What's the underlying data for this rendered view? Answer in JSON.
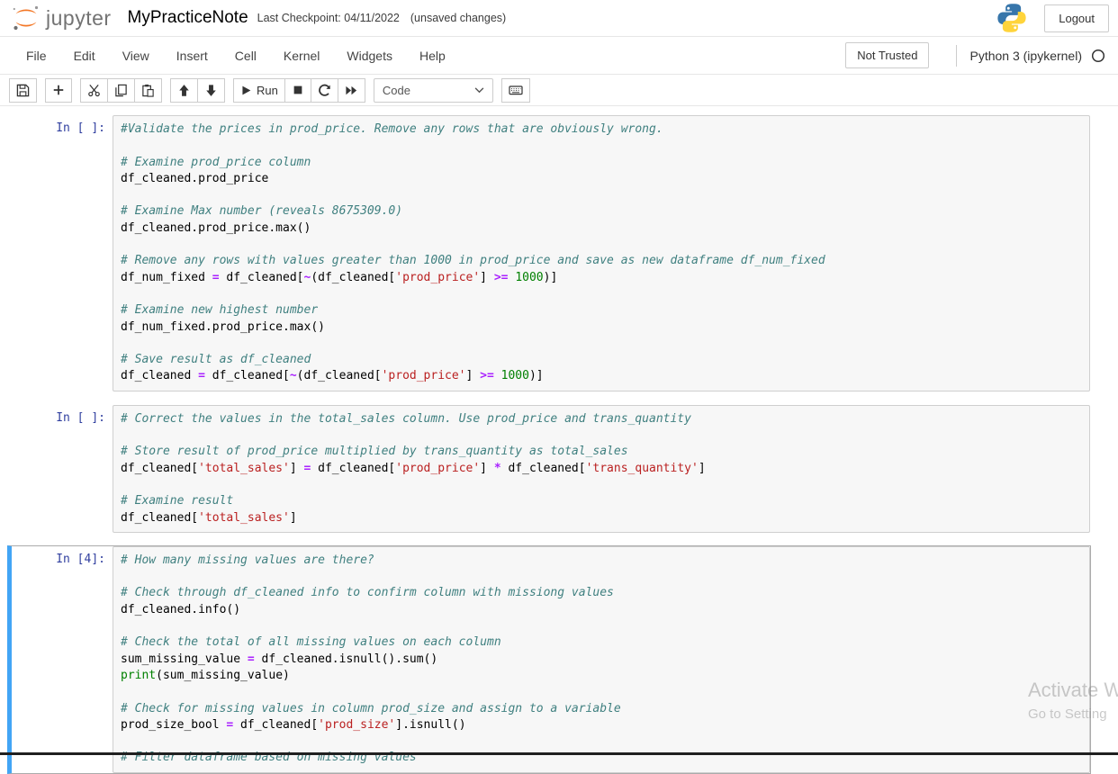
{
  "header": {
    "logo_text": "jupyter",
    "title": "MyPracticeNote",
    "checkpoint": "Last Checkpoint: 04/11/2022",
    "autosave_status": "(unsaved changes)",
    "logout_label": "Logout"
  },
  "menu": {
    "items": [
      "File",
      "Edit",
      "View",
      "Insert",
      "Cell",
      "Kernel",
      "Widgets",
      "Help"
    ],
    "not_trusted_label": "Not Trusted",
    "kernel_name": "Python 3 (ipykernel)"
  },
  "toolbar": {
    "run_label": "Run",
    "cell_type_value": "Code",
    "icons": [
      "save-icon",
      "add-cell-icon",
      "cut-cell-icon",
      "copy-cell-icon",
      "paste-cell-icon",
      "move-cell-up-icon",
      "move-cell-down-icon",
      "run-icon",
      "stop-icon",
      "restart-kernel-icon",
      "restart-run-all-icon",
      "dropdown-chevron-icon",
      "keyboard-icon",
      "kernel-idle-icon",
      "python-logo-icon",
      "jupyter-logo-icon"
    ]
  },
  "colors": {
    "jupyter_orange": "#F37726",
    "selected_cell_accent": "#42A5F5",
    "prompt_text": "#303F9F",
    "comment": "#408080",
    "string": "#BA2121",
    "operator": "#AA22FF",
    "number": "#008000",
    "builtin": "#008000"
  },
  "cells": [
    {
      "prompt": "In [ ]:",
      "selected": false,
      "lines": [
        [
          [
            "c",
            "#Validate the prices in prod_price. Remove any rows that are obviously wrong."
          ]
        ],
        [],
        [
          [
            "c",
            "# Examine prod_price column"
          ]
        ],
        [
          [
            "t",
            "df_cleaned.prod_price"
          ]
        ],
        [],
        [
          [
            "c",
            "# Examine Max number (reveals 8675309.0)"
          ]
        ],
        [
          [
            "t",
            "df_cleaned.prod_price.max()"
          ]
        ],
        [],
        [
          [
            "c",
            "# Remove any rows with values greater than 1000 in prod_price and save as new dataframe df_num_fixed"
          ]
        ],
        [
          [
            "t",
            "df_num_fixed "
          ],
          [
            "o",
            "="
          ],
          [
            "t",
            " df_cleaned["
          ],
          [
            "o",
            "~"
          ],
          [
            "t",
            "(df_cleaned["
          ],
          [
            "s",
            "'prod_price'"
          ],
          [
            "t",
            "] "
          ],
          [
            "o",
            ">="
          ],
          [
            "t",
            " "
          ],
          [
            "n",
            "1000"
          ],
          [
            "t",
            ")]"
          ]
        ],
        [],
        [
          [
            "c",
            "# Examine new highest number"
          ]
        ],
        [
          [
            "t",
            "df_num_fixed.prod_price.max()"
          ]
        ],
        [],
        [
          [
            "c",
            "# Save result as df_cleaned"
          ]
        ],
        [
          [
            "t",
            "df_cleaned "
          ],
          [
            "o",
            "="
          ],
          [
            "t",
            " df_cleaned["
          ],
          [
            "o",
            "~"
          ],
          [
            "t",
            "(df_cleaned["
          ],
          [
            "s",
            "'prod_price'"
          ],
          [
            "t",
            "] "
          ],
          [
            "o",
            ">="
          ],
          [
            "t",
            " "
          ],
          [
            "n",
            "1000"
          ],
          [
            "t",
            ")]"
          ]
        ]
      ]
    },
    {
      "prompt": "In [ ]:",
      "selected": false,
      "lines": [
        [
          [
            "c",
            "# Correct the values in the total_sales column. Use prod_price and trans_quantity"
          ]
        ],
        [],
        [
          [
            "c",
            "# Store result of prod_price multiplied by trans_quantity as total_sales"
          ]
        ],
        [
          [
            "t",
            "df_cleaned["
          ],
          [
            "s",
            "'total_sales'"
          ],
          [
            "t",
            "] "
          ],
          [
            "o",
            "="
          ],
          [
            "t",
            " df_cleaned["
          ],
          [
            "s",
            "'prod_price'"
          ],
          [
            "t",
            "] "
          ],
          [
            "o",
            "*"
          ],
          [
            "t",
            " df_cleaned["
          ],
          [
            "s",
            "'trans_quantity'"
          ],
          [
            "t",
            "]"
          ]
        ],
        [],
        [
          [
            "c",
            "# Examine result"
          ]
        ],
        [
          [
            "t",
            "df_cleaned["
          ],
          [
            "s",
            "'total_sales'"
          ],
          [
            "t",
            "]"
          ]
        ]
      ]
    },
    {
      "prompt": "In [4]:",
      "selected": true,
      "lines": [
        [
          [
            "c",
            "# How many missing values are there?"
          ]
        ],
        [],
        [
          [
            "c",
            "# Check through df_cleaned info to confirm column with missiong values"
          ]
        ],
        [
          [
            "t",
            "df_cleaned.info()"
          ]
        ],
        [],
        [
          [
            "c",
            "# Check the total of all missing values on each column"
          ]
        ],
        [
          [
            "t",
            "sum_missing_value "
          ],
          [
            "o",
            "="
          ],
          [
            "t",
            " df_cleaned.isnull().sum()"
          ]
        ],
        [
          [
            "b",
            "print"
          ],
          [
            "t",
            "(sum_missing_value)"
          ]
        ],
        [],
        [
          [
            "c",
            "# Check for missing values in column prod_size and assign to a variable"
          ]
        ],
        [
          [
            "t",
            "prod_size_bool "
          ],
          [
            "o",
            "="
          ],
          [
            "t",
            " df_cleaned["
          ],
          [
            "s",
            "'prod_size'"
          ],
          [
            "t",
            "].isnull()"
          ]
        ],
        [],
        [
          [
            "c",
            "# Filter dataframe based on missing values"
          ]
        ]
      ]
    }
  ],
  "watermark": {
    "line1": "Activate W",
    "line2": "Go to Setting"
  }
}
